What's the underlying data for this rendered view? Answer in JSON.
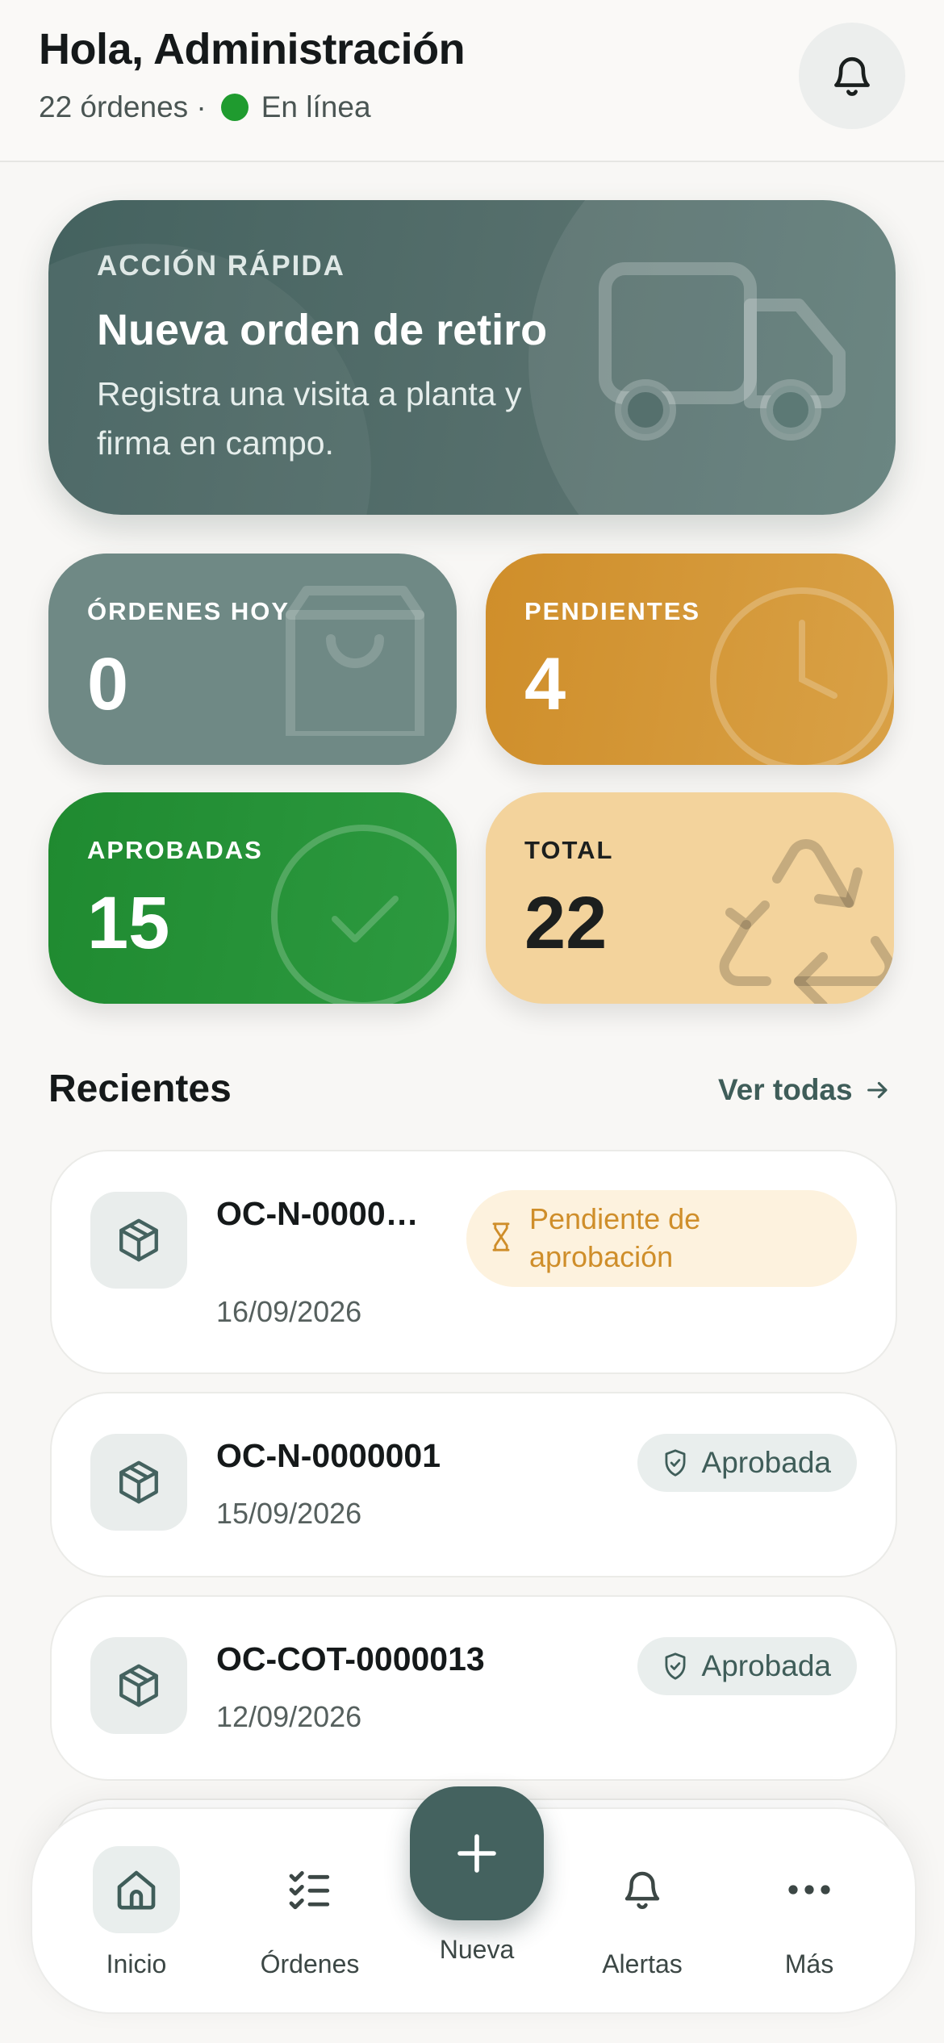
{
  "header": {
    "greeting": "Hola, Administración",
    "orders_count": "22 órdenes ·",
    "status": "En línea",
    "status_color": "#1f9b2f",
    "bell_icon": "bell-icon"
  },
  "quick_action": {
    "kicker": "ACCIÓN RÁPIDA",
    "title": "Nueva orden de retiro",
    "description": "Registra una visita a planta y firma en campo.",
    "icon": "truck-icon"
  },
  "stats": [
    {
      "label": "ÓRDENES HOY",
      "value": "0",
      "icon": "bag-icon",
      "color": "#6f8985"
    },
    {
      "label": "PENDIENTES",
      "value": "4",
      "icon": "clock-icon",
      "color": "#cf8e2a"
    },
    {
      "label": "APROBADAS",
      "value": "15",
      "icon": "check-circle-icon",
      "color": "#1f8a30"
    },
    {
      "label": "TOTAL",
      "value": "22",
      "icon": "recycle-icon",
      "color": "#f3d39c"
    }
  ],
  "recent": {
    "title": "Recientes",
    "see_all": "Ver todas",
    "orders": [
      {
        "code": "OC-N-0000…",
        "date": "16/09/2026",
        "status": "Pendiente de aprobación",
        "status_icon": "hourglass-icon",
        "status_color": "#cf8e2a"
      },
      {
        "code": "OC-N-0000001",
        "date": "15/09/2026",
        "status": "Aprobada",
        "status_icon": "shield-check-icon",
        "status_color": "#3f5d59"
      },
      {
        "code": "OC-COT-0000013",
        "date": "12/09/2026",
        "status": "Aprobada",
        "status_icon": "shield-check-icon",
        "status_color": "#3f5d59"
      }
    ]
  },
  "nav": {
    "items": [
      {
        "label": "Inicio",
        "icon": "home-icon",
        "active": true
      },
      {
        "label": "Órdenes",
        "icon": "checklist-icon"
      },
      {
        "label": "Nueva",
        "icon": "plus-icon"
      },
      {
        "label": "Alertas",
        "icon": "bell-icon"
      },
      {
        "label": "Más",
        "icon": "more-icon"
      }
    ]
  },
  "colors": {
    "accent": "#44625f",
    "background": "#f8f7f5"
  }
}
